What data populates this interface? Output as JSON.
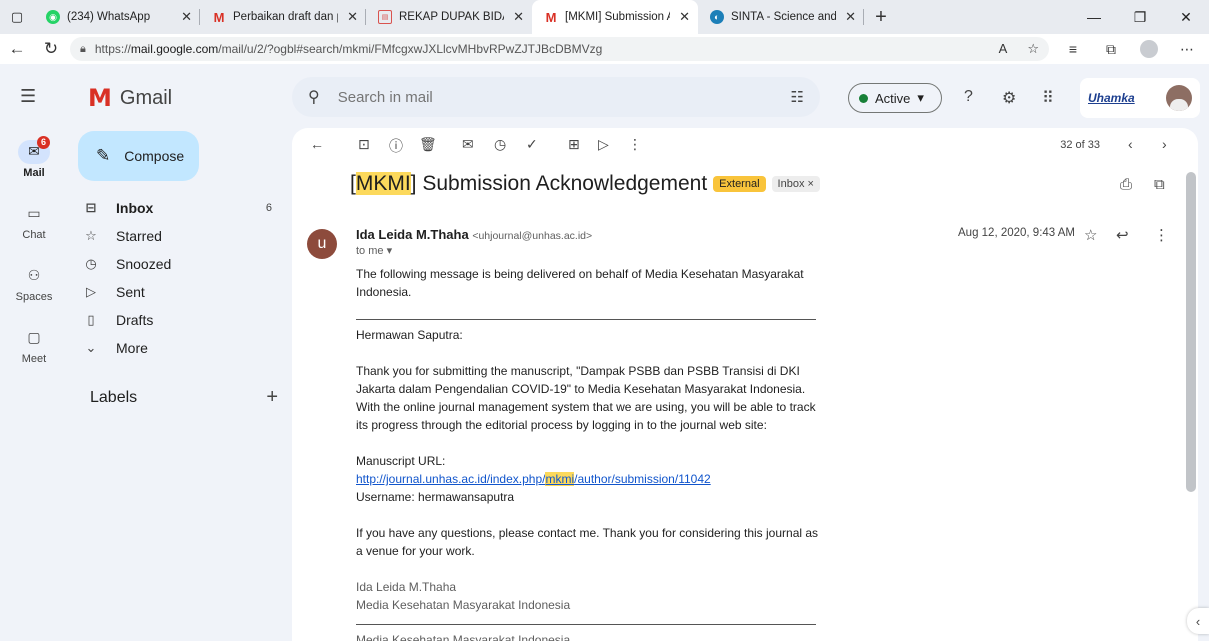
{
  "browser": {
    "tabs": [
      {
        "title": "(234) WhatsApp",
        "icon": "whatsapp-icon",
        "active": false
      },
      {
        "title": "Perbaikan draft dan pembaya",
        "icon": "gmail-icon",
        "active": false
      },
      {
        "title": "REKAP DUPAK BIDANG B _ LL",
        "icon": "document-icon",
        "active": false
      },
      {
        "title": "[MKMI] Submission Acknowle",
        "icon": "gmail-icon",
        "active": true
      },
      {
        "title": "SINTA - Science and Technolo",
        "icon": "sinta-icon",
        "active": false
      }
    ],
    "url_prefix": "https://",
    "url_host": "mail.google.com",
    "url_path": "/mail/u/2/?ogbl#search/mkmi/FMfcgxwJXLlcvMHbvRPwZJTJBcDBMVzg"
  },
  "gmail": {
    "brand": "Gmail",
    "search_placeholder": "Search in mail",
    "status_label": "Active",
    "account_logo_text": "Uhamka",
    "compose_label": "Compose",
    "rail": [
      {
        "label": "Mail",
        "icon": "mail-icon",
        "badge": "6"
      },
      {
        "label": "Chat",
        "icon": "chat-icon"
      },
      {
        "label": "Spaces",
        "icon": "spaces-icon"
      },
      {
        "label": "Meet",
        "icon": "meet-icon"
      }
    ],
    "nav": [
      {
        "label": "Inbox",
        "icon": "inbox-icon",
        "count": "6"
      },
      {
        "label": "Starred",
        "icon": "star-icon",
        "count": ""
      },
      {
        "label": "Snoozed",
        "icon": "clock-icon",
        "count": ""
      },
      {
        "label": "Sent",
        "icon": "send-icon",
        "count": ""
      },
      {
        "label": "Drafts",
        "icon": "draft-icon",
        "count": ""
      },
      {
        "label": "More",
        "icon": "chevron-down-icon",
        "count": ""
      }
    ],
    "labels_heading": "Labels"
  },
  "message": {
    "pager": "32 of 33",
    "subject_prefix": "[",
    "subject_highlight": "MKMI",
    "subject_rest": "] Submission Acknowledgement",
    "chip_external": "External",
    "chip_inbox": "Inbox ×",
    "avatar_letter": "u",
    "sender_name": "Ida Leida M.Thaha",
    "sender_email": "<uhjournal@unhas.ac.id>",
    "to": "to me ▾",
    "date": "Aug 12, 2020, 9:43 AM",
    "intro": "The following message is being delivered on behalf of Media Kesehatan Masyarakat Indonesia.",
    "greeting": "Hermawan Saputra:",
    "para1": "Thank you for submitting the manuscript, \"Dampak PSBB dan PSBB Transisi di DKI Jakarta dalam Pengendalian COVID-19\" to Media Kesehatan Masyarakat Indonesia. With the online journal management system that we are using, you will be able to track its progress through the editorial process by logging in to the journal web site:",
    "url_label": "Manuscript URL:",
    "link_before": "http://journal.unhas.ac.id/index.php/",
    "link_highlight": "mkmi",
    "link_after": "/author/submission/11042",
    "username": "Username: hermawansaputra",
    "para2": "If you have any questions, please contact me. Thank you for considering this journal as a venue for your work.",
    "sig_name": "Ida Leida M.Thaha",
    "sig_org": "Media Kesehatan Masyarakat Indonesia",
    "footer_org": "Media Kesehatan Masyarakat Indonesia"
  }
}
